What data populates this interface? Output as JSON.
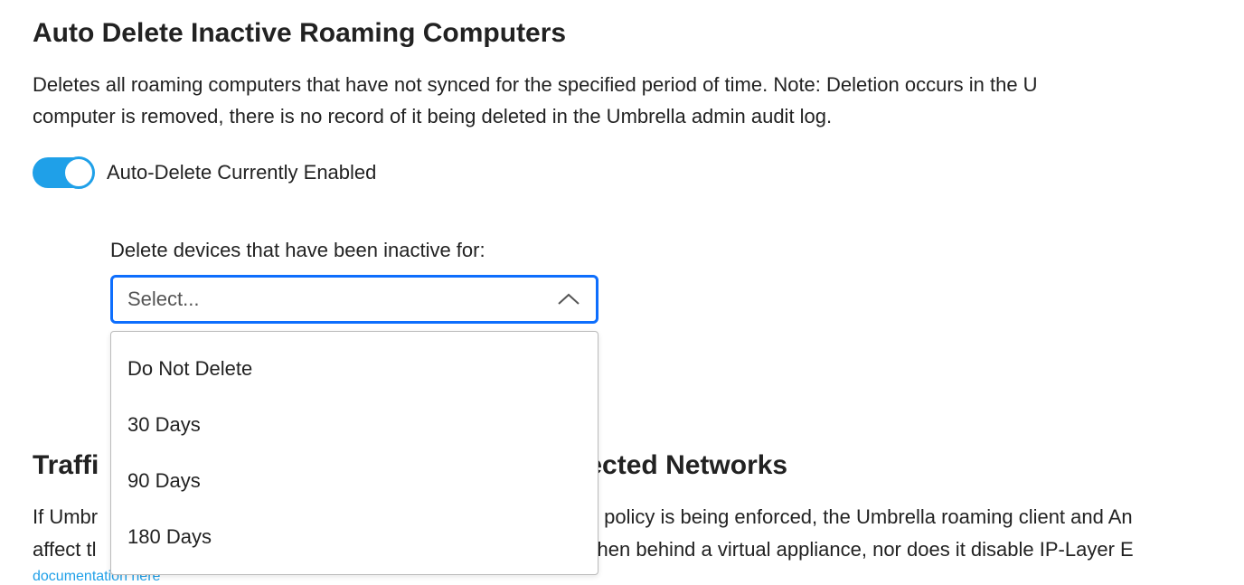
{
  "autoDelete": {
    "title": "Auto Delete Inactive Roaming Computers",
    "description_line1": "Deletes all roaming computers that have not synced for the specified period of time. Note: Deletion occurs in the U",
    "description_line2": "computer is removed, there is no record of it being deleted in the Umbrella admin audit log.",
    "toggle_enabled": true,
    "toggle_label": "Auto-Delete Currently Enabled",
    "field_label": "Delete devices that have been inactive for:",
    "select_placeholder": "Select...",
    "options": [
      {
        "label": "Do Not Delete"
      },
      {
        "label": "30 Days"
      },
      {
        "label": "90 Days"
      },
      {
        "label": "180 Days"
      }
    ]
  },
  "traffic": {
    "title_left": "Traffi",
    "title_right": "ected Networks",
    "desc_left_1": "If Umbr",
    "desc_right_1": "policy is being enforced, the Umbrella roaming client and An",
    "desc_left_2": "affect tl",
    "desc_right_2": "hen behind a virtual appliance, nor does it disable IP-Layer E",
    "doc_link": "documentation here"
  }
}
